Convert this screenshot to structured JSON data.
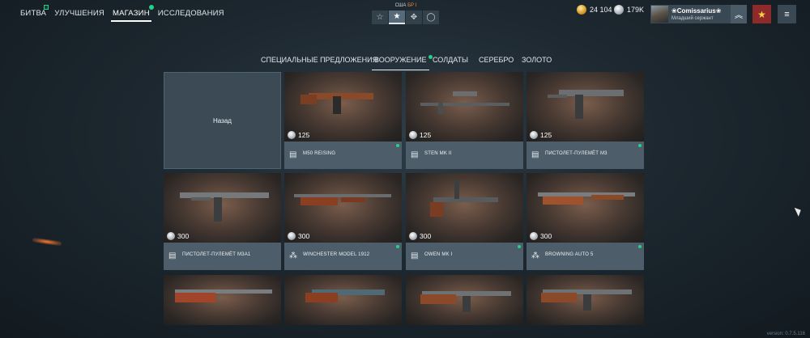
{
  "top_nav": {
    "tabs": [
      {
        "label": "БИТВА",
        "active": false,
        "badge": "square"
      },
      {
        "label": "УЛУЧШЕНИЯ",
        "active": false
      },
      {
        "label": "МАГАЗИН",
        "active": true,
        "badge": "dot"
      },
      {
        "label": "ИССЛЕДОВАНИЯ",
        "active": false
      }
    ]
  },
  "mode_selector": {
    "prefix": "США ",
    "br": "БР I",
    "buttons": [
      {
        "icon": "star-outline-icon",
        "glyph": "☆",
        "active": false
      },
      {
        "icon": "star-filled-icon",
        "glyph": "★",
        "active": true
      },
      {
        "icon": "crosshair-icon",
        "glyph": "✥",
        "active": false
      },
      {
        "icon": "circle-icon",
        "glyph": "◯",
        "active": false
      }
    ]
  },
  "currencies": {
    "gold": "24 104",
    "silver": "179K"
  },
  "profile": {
    "name": "❀Comissarius❀",
    "rank": "Младший сержант",
    "chevron_glyph": "︽"
  },
  "menu_glyph": "≡",
  "medal_glyph": "★",
  "shop_tabs": [
    {
      "label": "СПЕЦИАЛЬНЫЕ ПРЕДЛОЖЕНИЯ",
      "active": false
    },
    {
      "label": "ВООРУЖЕНИЕ",
      "active": true,
      "badge": true
    },
    {
      "label": "СОЛДАТЫ",
      "active": false
    },
    {
      "label": "СЕРЕБРО",
      "active": false
    },
    {
      "label": "ЗОЛОТО",
      "active": false
    }
  ],
  "back_label": "Назад",
  "items": [
    {
      "name": "M50 REISING",
      "price": "125",
      "type": "magazine-icon",
      "glyph": "▤",
      "new": true
    },
    {
      "name": "STEN MK II",
      "price": "125",
      "type": "magazine-icon",
      "glyph": "▤",
      "new": false
    },
    {
      "name": "ПИСТОЛЕТ-ПУЛЕМЁТ M3",
      "price": "125",
      "type": "magazine-icon",
      "glyph": "▤",
      "new": true
    },
    {
      "name": "ПИСТОЛЕТ-ПУЛЕМЁТ M3A1",
      "price": "300",
      "type": "magazine-icon",
      "glyph": "▤",
      "new": false
    },
    {
      "name": "WINCHESTER MODEL 1912",
      "price": "300",
      "type": "shotgun-shell-icon",
      "glyph": "⁂",
      "new": true
    },
    {
      "name": "OWEN MK I",
      "price": "300",
      "type": "magazine-icon",
      "glyph": "▤",
      "new": true
    },
    {
      "name": "BROWNING AUTO 5",
      "price": "300",
      "type": "shotgun-shell-icon",
      "glyph": "⁂",
      "new": true
    },
    {
      "name": "",
      "price": "",
      "type": "",
      "glyph": "",
      "new": false
    },
    {
      "name": "",
      "price": "",
      "type": "",
      "glyph": "",
      "new": false
    },
    {
      "name": "",
      "price": "",
      "type": "",
      "glyph": "",
      "new": false
    },
    {
      "name": "",
      "price": "",
      "type": "",
      "glyph": "",
      "new": false
    }
  ],
  "version": "version: 0.7.5.116"
}
